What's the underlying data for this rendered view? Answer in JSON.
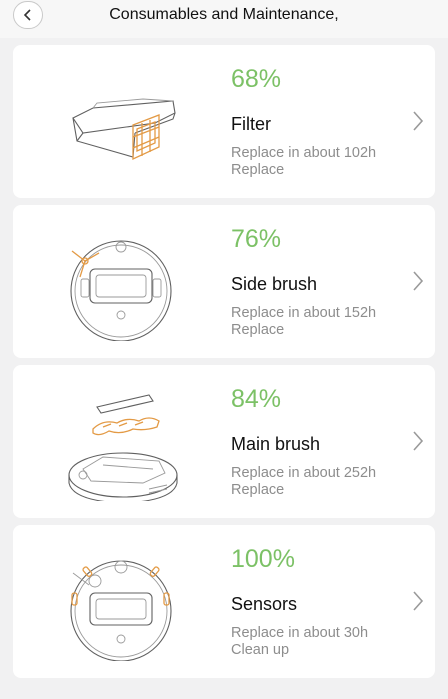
{
  "header": {
    "title": "Consumables and Maintenance,"
  },
  "items": [
    {
      "percent": "68%",
      "name": "Filter",
      "remaining": "Replace in about 102h",
      "action": "Replace",
      "icon": "filter-icon"
    },
    {
      "percent": "76%",
      "name": "Side brush",
      "remaining": "Replace in about 152h",
      "action": "Replace",
      "icon": "side-brush-icon"
    },
    {
      "percent": "84%",
      "name": "Main brush",
      "remaining": "Replace in about 252h",
      "action": "Replace",
      "icon": "main-brush-icon"
    },
    {
      "percent": "100%",
      "name": "Sensors",
      "remaining": "Replace in about 30h",
      "action": "Clean up",
      "icon": "sensors-icon"
    }
  ],
  "colors": {
    "accent": "#7cc166",
    "illustration_orange": "#e39a45"
  }
}
